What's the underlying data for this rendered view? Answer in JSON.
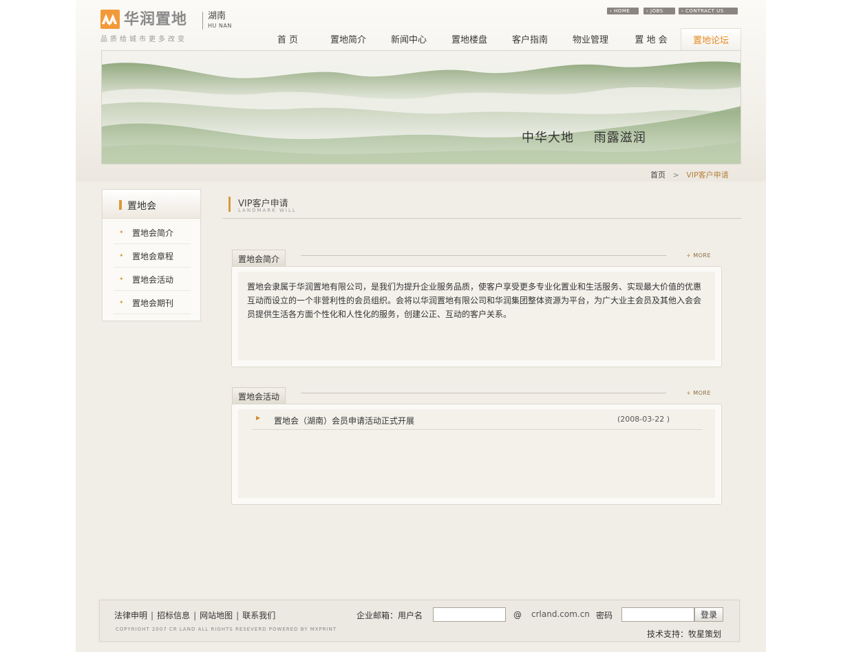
{
  "logo": {
    "name": "华润置地",
    "region": "湖南",
    "region_en": "HU NAN",
    "slogan": "品质给城市更多改变"
  },
  "top_links": [
    "HOME",
    "JOBS",
    "CONTRACT US"
  ],
  "nav": {
    "items": [
      "首 页",
      "置地简介",
      "新闻中心",
      "置地楼盘",
      "客户指南",
      "物业管理",
      "置 地 会",
      "置地论坛"
    ],
    "active_index": 7
  },
  "banner": {
    "text_1": "中华大地",
    "text_2": "雨露滋润"
  },
  "breadcrumb": {
    "home": "首页",
    "separator": ">",
    "current": "VIP客户申请"
  },
  "sidebar": {
    "title": "置地会",
    "items": [
      "置地会简介",
      "置地会章程",
      "置地会活动",
      "置地会期刊"
    ]
  },
  "main": {
    "title": "VIP客户申请",
    "subtitle": "LANDMARK WILL"
  },
  "intro_panel": {
    "title": "置地会简介",
    "more": "MORE",
    "text": "置地会隶属于华润置地有限公司，是我们为提升企业服务品质，使客户享受更多专业化置业和生活服务、实现最大价值的优惠互动而设立的一个非营利性的会员组织。会将以华润置地有限公司和华润集团整体资源为平台，为广大业主会员及其他入会会员提供生活各方面个性化和人性化的服务，创建公正、互动的客户关系。"
  },
  "activity_panel": {
    "title": "置地会活动",
    "more": "MORE",
    "items": [
      {
        "title": "置地会（湖南）会员申请活动正式开展",
        "date": "(2008-03-22 )"
      }
    ]
  },
  "footer": {
    "links": [
      "法律申明",
      "招标信息",
      "网站地图",
      "联系我们"
    ],
    "link_separator": "|",
    "copyright": "COPYRIGHT 2007 CR LAND  ALL RIGHTS RESEVERD  POWERED BY MXPRINT",
    "mail_label": "企业邮箱：用户名",
    "username_value": "",
    "at_sign": "@",
    "mail_domain": "crland.com.cn",
    "password_label": "密码",
    "password_value": "",
    "login_label": "登录",
    "tech_support": "技术支持：牧星策划"
  },
  "colors": {
    "accent_orange": "#e88b25",
    "page_bg": "#f1eee8",
    "bar_gold": "#d89a3a"
  }
}
